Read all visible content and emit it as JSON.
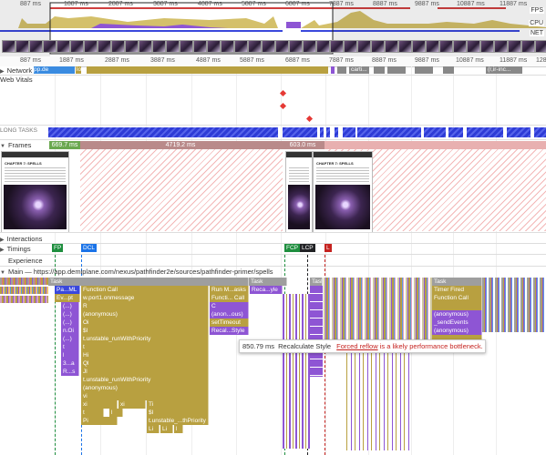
{
  "overview": {
    "ticks": [
      "887 ms",
      "1887 ms",
      "2887 ms",
      "3887 ms",
      "4887 ms",
      "5887 ms",
      "6887 ms",
      "7887 ms",
      "8887 ms",
      "9887 ms",
      "10887 ms",
      "11887 ms",
      "128"
    ],
    "labels": {
      "fps": "FPS",
      "cpu": "CPU",
      "net": "NET"
    }
  },
  "ruler": {
    "ticks": [
      "887 ms",
      "1887 ms",
      "2887 ms",
      "3887 ms",
      "4887 ms",
      "5887 ms",
      "6887 ms",
      "7887 ms",
      "8887 ms",
      "9887 ms",
      "10887 ms",
      "11887 ms",
      "128"
    ]
  },
  "tracks": {
    "network": "Network",
    "network_item": "pp.de",
    "network_item2": "lo",
    "network_item3": "carti...",
    "network_item4": "(r,ir-inc...",
    "web_vitals": "Web Vitals",
    "long_tasks": "LONG TASKS",
    "frames": "Frames",
    "interactions": "Interactions",
    "timings": "Timings",
    "experience": "Experience",
    "main": "Main — https://app.demiplane.com/nexus/pathfinder2e/sources/pathfinder-primer/spells"
  },
  "frames": {
    "f1": "669.7 ms",
    "f2": "4719.2 ms",
    "f3": "603.0 ms"
  },
  "screenshot": {
    "title": "CHAPTER 7: SPELLS"
  },
  "timings": {
    "fp": "FP",
    "dcl": "DCL",
    "fcp": "FCP",
    "lcp": "LCP",
    "l": "L"
  },
  "flame": {
    "task": "Task",
    "pa_ml": "Pa...ML",
    "function_call": "Function Call",
    "ev_pt": "Ev...pt",
    "w_port": "w.port1.onmessage",
    "r": "R",
    "anon": "(anonymous)",
    "oi": "Oi",
    "sl": "$l",
    "t_unstable": "t.unstable_runWithPriority",
    "t": "t",
    "hi": "Hi",
    "ql": "Ql",
    "jl": "Jl",
    "vi": "vi",
    "xi": "xi",
    "ti": "Ti",
    "pi": "Pi",
    "dots": "(...)",
    "n_oi": "n.Oi",
    "three_a": "3...a",
    "r_s": "R...s",
    "short_t": "t",
    "short_l": "l",
    "short_i": "i",
    "t_unstable_short": "t.unstable_...thPriority",
    "li": "Li",
    "run_m": "Run M...asks",
    "functi_call": "Functi... Call",
    "c": "C",
    "anonous": "(anon...ous)",
    "settimeout": "setTimeout",
    "recal_style": "Recal...Style",
    "reca_yle": "Reca...yle",
    "timer_fired": "Timer Fired",
    "send_events": "_sendEvents",
    "anon2": "(anonymous)",
    "blank": ""
  },
  "tooltip": {
    "duration": "850.79 ms",
    "name": "Recalculate Style",
    "warning": "Forced reflow",
    "warning_rest": "is a likely performance bottleneck."
  },
  "colors": {
    "task_gray": "#9e9e9e",
    "script_gold": "#b8a040",
    "render_purple": "#8e55d4",
    "rendering_purple2": "#9c6adc",
    "long_task_blue": "#3a48dc",
    "frame_green": "#6aa84f",
    "frame_rose": "#b98a8a",
    "fp_green": "#1e8e3e",
    "dcl_blue": "#1a73e8",
    "lcp_black": "#202124",
    "l_red": "#c5221f",
    "warning_red": "#c5221f"
  }
}
